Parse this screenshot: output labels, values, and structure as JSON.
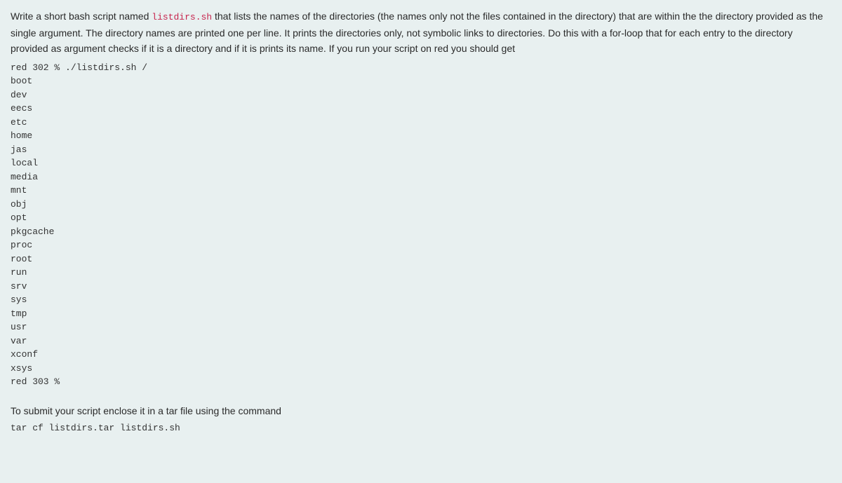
{
  "instruction": {
    "part1": "Write a short bash script named ",
    "codeFilename": "listdirs.sh",
    "part2": " that lists the names of the directories (the names only not the files contained in the directory) that are within the the directory provided as the single argument. The directory names are printed one per line. It prints the directories only, not symbolic links to directories. Do this with a for-loop that for each entry to the directory provided as argument checks if it is a directory and if it is prints its name. If you run your script on red you should get"
  },
  "terminalOutput": "red 302 % ./listdirs.sh /\nboot\ndev\neecs\netc\nhome\njas\nlocal\nmedia\nmnt\nobj\nopt\npkgcache\nproc\nroot\nrun\nsrv\nsys\ntmp\nusr\nvar\nxconf\nxsys\nred 303 %",
  "submitInstruction": "To submit your script enclose it in a tar file using the command",
  "tarCommand": "tar cf listdirs.tar listdirs.sh"
}
